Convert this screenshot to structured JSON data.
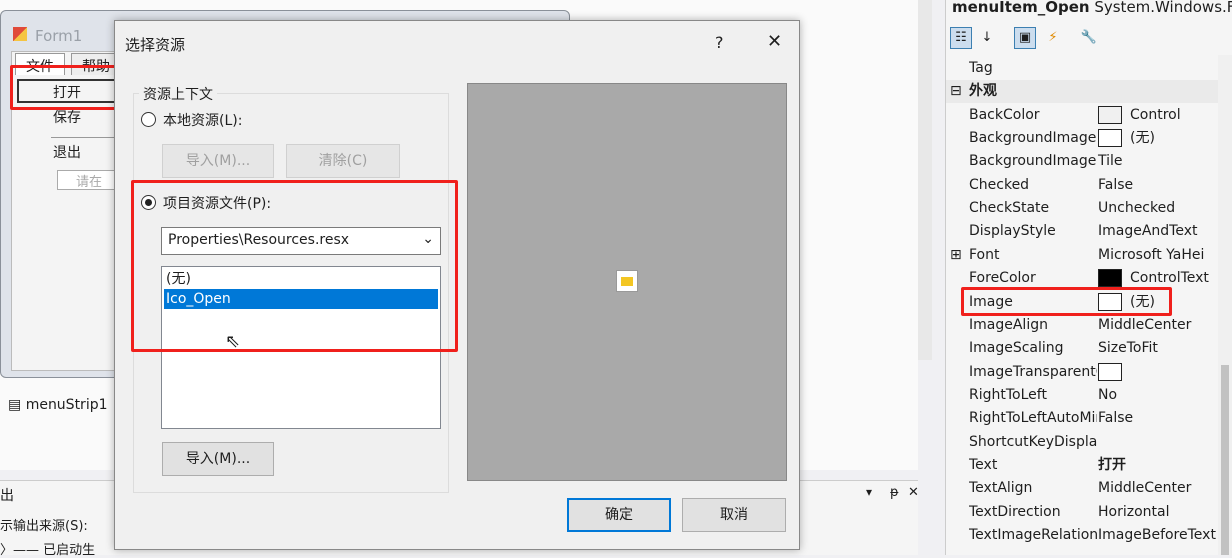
{
  "form1": {
    "title": "Form1",
    "menu": [
      "文件",
      "帮助"
    ],
    "dropdown": [
      "打开",
      "保存",
      "退出"
    ],
    "textbox_placeholder": "请在"
  },
  "component_tray": {
    "item": "menuStrip1"
  },
  "output": {
    "title": "出",
    "source_label": "示输出来源(S):",
    "line": "〉—— 已启动生",
    "buttons": [
      "▾",
      "ᵽ",
      "✕"
    ]
  },
  "dialog": {
    "title": "选择资源",
    "help": "?",
    "close": "✕",
    "group": "资源上下文",
    "local_radio": "本地资源(L):",
    "import_disabled": "导入(M)...",
    "clear": "清除(C)",
    "project_radio": "项目资源文件(P):",
    "resource_file": "Properties\\Resources.resx",
    "list": [
      "(无)",
      "Ico_Open"
    ],
    "selected_index": 1,
    "import": "导入(M)...",
    "ok": "确定",
    "cancel": "取消"
  },
  "properties": {
    "object": "menuItem_Open",
    "type": "System.Windows.Fc",
    "rows": [
      {
        "name": "Tag",
        "value": ""
      },
      {
        "name": "外观",
        "value": "",
        "category": true
      },
      {
        "name": "BackColor",
        "value": "Control",
        "swatch": "#f0f0f0"
      },
      {
        "name": "BackgroundImage",
        "value": "(无)",
        "swatch": "#ffffff"
      },
      {
        "name": "BackgroundImageLayout",
        "value": "Tile"
      },
      {
        "name": "Checked",
        "value": "False"
      },
      {
        "name": "CheckState",
        "value": "Unchecked"
      },
      {
        "name": "DisplayStyle",
        "value": "ImageAndText"
      },
      {
        "name": "Font",
        "value": "Microsoft YaHei",
        "expand": true
      },
      {
        "name": "ForeColor",
        "value": "ControlText",
        "swatch": "#000000"
      },
      {
        "name": "Image",
        "value": "(无)",
        "swatch": "#ffffff"
      },
      {
        "name": "ImageAlign",
        "value": "MiddleCenter"
      },
      {
        "name": "ImageScaling",
        "value": "SizeToFit"
      },
      {
        "name": "ImageTransparentColor",
        "value": "",
        "swatch": "#ffffff"
      },
      {
        "name": "RightToLeft",
        "value": "No"
      },
      {
        "name": "RightToLeftAutoMirrorImage",
        "value": "False"
      },
      {
        "name": "ShortcutKeyDisplayString",
        "value": ""
      },
      {
        "name": "Text",
        "value": "打开",
        "bold": true
      },
      {
        "name": "TextAlign",
        "value": "MiddleCenter"
      },
      {
        "name": "TextDirection",
        "value": "Horizontal"
      },
      {
        "name": "TextImageRelation",
        "value": "ImageBeforeText"
      }
    ]
  },
  "colors": {
    "highlight": "#f0201c",
    "selection": "#0078d7"
  }
}
